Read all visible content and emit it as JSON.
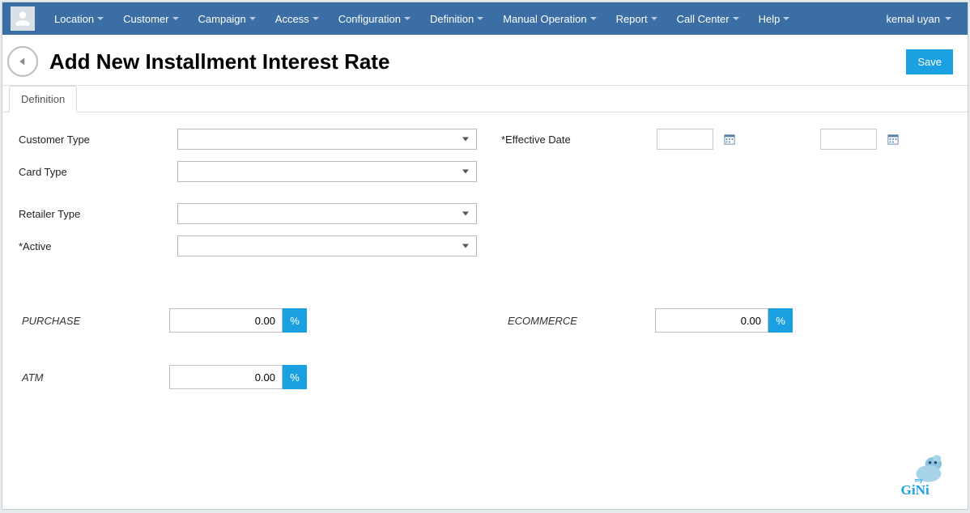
{
  "nav": {
    "items": [
      {
        "label": "Location"
      },
      {
        "label": "Customer"
      },
      {
        "label": "Campaign"
      },
      {
        "label": "Access"
      },
      {
        "label": "Configuration"
      },
      {
        "label": "Definition"
      },
      {
        "label": "Manual Operation"
      },
      {
        "label": "Report"
      },
      {
        "label": "Call Center"
      },
      {
        "label": "Help"
      }
    ],
    "user": "kemal uyan"
  },
  "header": {
    "title": "Add New Installment Interest Rate",
    "save_label": "Save"
  },
  "tabs": [
    {
      "label": "Definition"
    }
  ],
  "form": {
    "left_fields": [
      {
        "label": "Customer Type"
      },
      {
        "label": "Card Type"
      },
      {
        "label": "Retailer Type"
      },
      {
        "label": "*Active"
      }
    ],
    "effective_date_label": "*Effective Date",
    "date_from": "",
    "date_to": ""
  },
  "rates": {
    "purchase_label": "PURCHASE",
    "purchase_value": "0.00",
    "ecommerce_label": "ECOMMERCE",
    "ecommerce_value": "0.00",
    "atm_label": "ATM",
    "atm_value": "0.00",
    "pct_symbol": "%"
  },
  "logo": {
    "text_my": "my",
    "text_brand": "GiNi"
  }
}
